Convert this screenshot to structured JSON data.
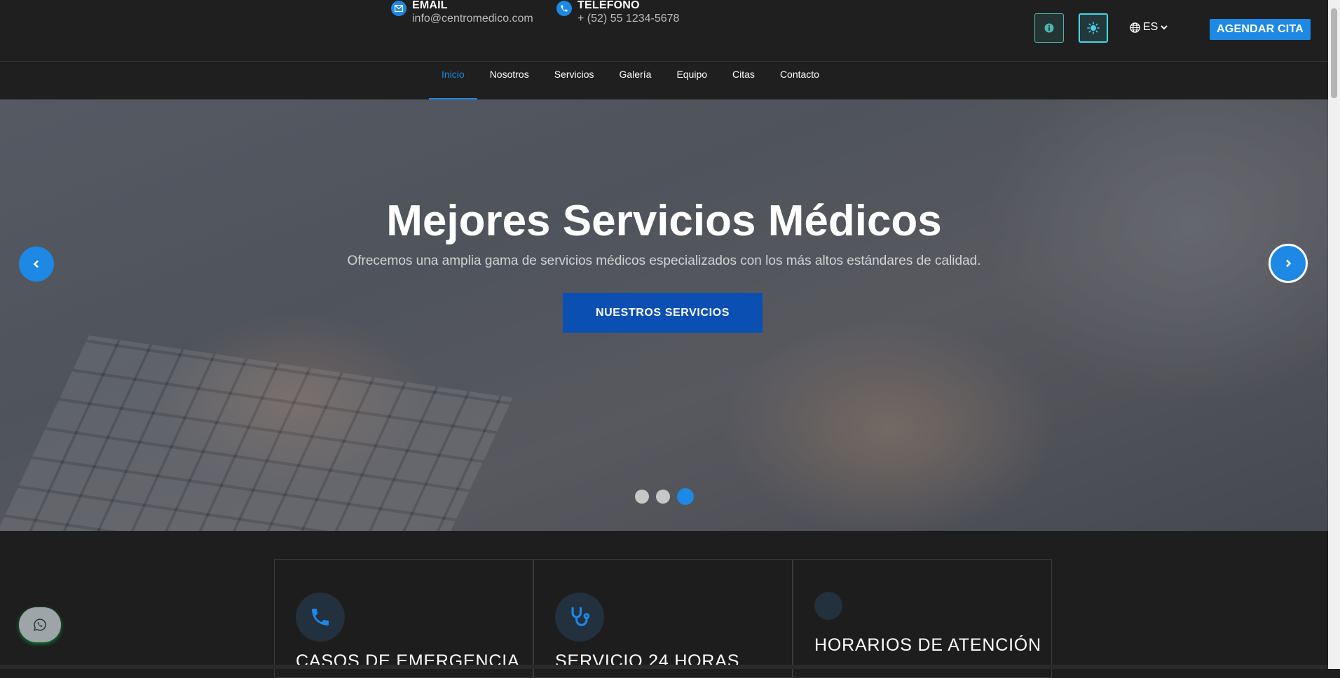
{
  "topbar": {
    "email": {
      "label": "EMAIL",
      "value": "info@centromedico.com"
    },
    "phone": {
      "label": "TELÉFONO",
      "value": "+ (52) 55 1234-5678"
    },
    "language": "ES",
    "appointment_button": "AGENDAR CITA"
  },
  "nav": {
    "items": [
      "Inicio",
      "Nosotros",
      "Servicios",
      "Galería",
      "Equipo",
      "Citas",
      "Contacto"
    ],
    "active": "Inicio"
  },
  "hero": {
    "title": "Mejores Servicios Médicos",
    "subtitle": "Ofrecemos una amplia gama de servicios médicos especializados con los más altos estándares de calidad.",
    "button": "NUESTROS SERVICIOS",
    "slide_count": 3,
    "active_slide": 3
  },
  "cards": [
    {
      "icon": "phone-icon",
      "title": "CASOS DE EMERGENCIA"
    },
    {
      "icon": "stethoscope-icon",
      "title": "SERVICIO 24 HORAS"
    },
    {
      "icon": "clock-icon",
      "title": "HORARIOS DE ATENCIÓN"
    }
  ],
  "colors": {
    "accent": "#1e88e5",
    "background": "#1e1e1e",
    "hero_button": "#0b4fb3",
    "teal_border": "#4db6ac"
  }
}
